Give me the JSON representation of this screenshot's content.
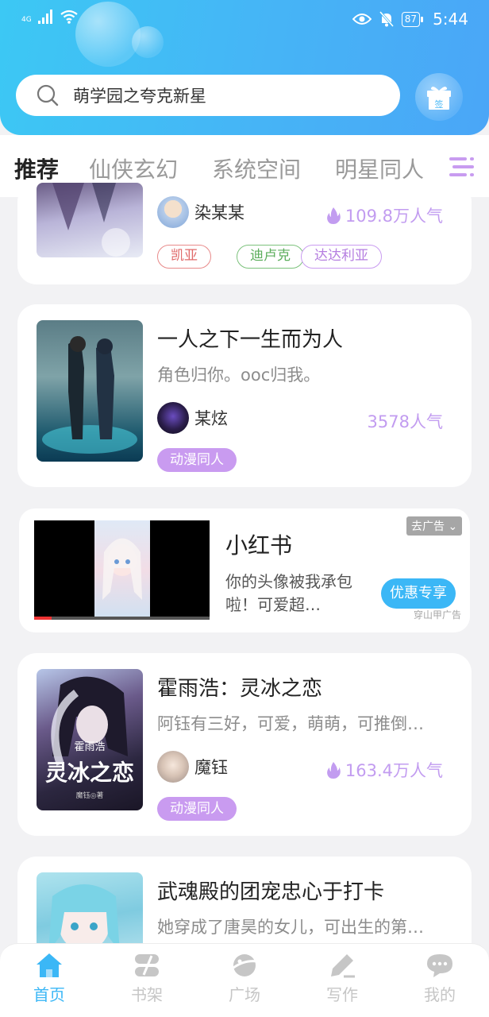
{
  "status_bar": {
    "network": "4G",
    "battery": "87",
    "time": "5:44"
  },
  "search": {
    "placeholder": "萌学园之夸克新星"
  },
  "gift_button": {
    "label": "签"
  },
  "tabs": [
    {
      "label": "推荐",
      "active": true
    },
    {
      "label": "仙侠玄幻"
    },
    {
      "label": "系统空间"
    },
    {
      "label": "明星同人"
    }
  ],
  "cards": [
    {
      "author": "染某某",
      "popularity": "109.8万人气",
      "tags": [
        "凯亚",
        "迪卢克",
        "达达利亚"
      ]
    },
    {
      "title": "一人之下一生而为人",
      "desc": "角色归你。ooc归我。",
      "author": "某炫",
      "popularity": "3578人气",
      "tag": "动漫同人"
    },
    {
      "title": "霍雨浩：灵冰之恋",
      "desc": "阿钰有三好，可爱，萌萌，可推倒…",
      "author": "魔钰",
      "popularity": "163.4万人气",
      "tag": "动漫同人",
      "cover_text": "灵冰之恋",
      "cover_top": "霍雨浩",
      "cover_bottom": "魔钰◎著"
    },
    {
      "title": "武魂殿的团宠忠心于打卡",
      "desc": "她穿成了唐昊的女儿，可出生的第…"
    }
  ],
  "ad": {
    "title": "小红书",
    "desc": "你的头像被我承包啦！可爱超…",
    "badge": "去广告",
    "cta": "优惠专享",
    "source": "穿山甲广告"
  },
  "bottom_nav": [
    {
      "label": "首页",
      "icon": "home-icon",
      "active": true
    },
    {
      "label": "书架",
      "icon": "bookshelf-icon"
    },
    {
      "label": "广场",
      "icon": "planet-icon"
    },
    {
      "label": "写作",
      "icon": "pen-icon"
    },
    {
      "label": "我的",
      "icon": "chat-bubble-icon"
    }
  ],
  "colors": {
    "accent": "#3bb7f6",
    "purple": "#c99bf0",
    "header_gradient_start": "#3cc8f4",
    "header_gradient_end": "#4aa6f7"
  }
}
